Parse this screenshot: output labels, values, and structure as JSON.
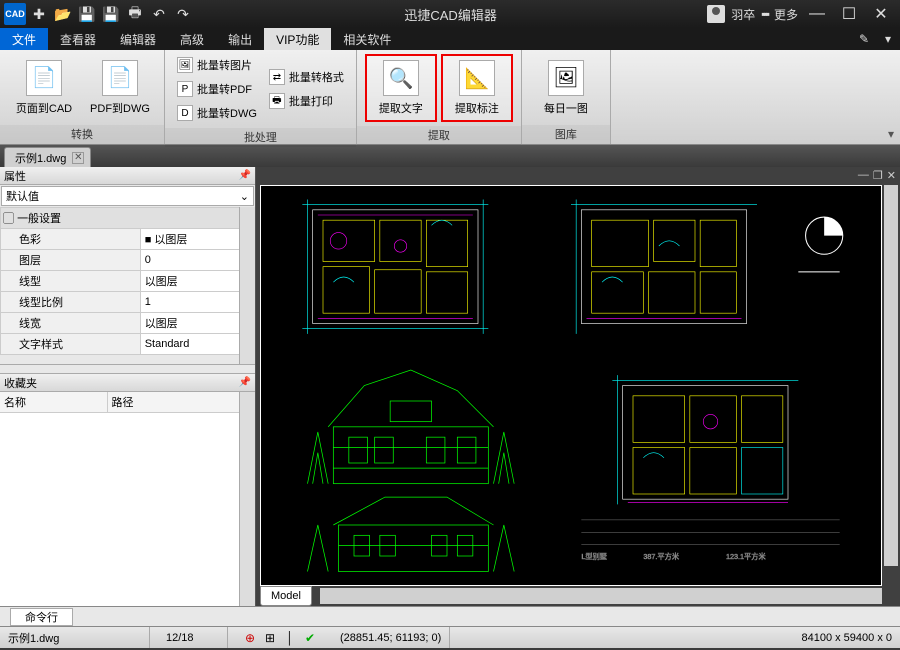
{
  "app": {
    "title": "迅捷CAD编辑器",
    "user": "羽卒",
    "more": "更多"
  },
  "menutabs": {
    "file": "文件",
    "items": [
      "查看器",
      "编辑器",
      "高级",
      "输出",
      "VIP功能",
      "相关软件"
    ],
    "active_index": 4
  },
  "ribbon": {
    "groups": [
      {
        "caption": "转换",
        "big": [
          {
            "label": "页面到CAD"
          },
          {
            "label": "PDF到DWG"
          }
        ]
      },
      {
        "caption": "批处理",
        "small_col1": [
          {
            "label": "批量转图片"
          },
          {
            "label": "批量转PDF"
          },
          {
            "label": "批量转DWG"
          }
        ],
        "small_col2": [
          {
            "label": "批量转格式"
          },
          {
            "label": "批量打印"
          }
        ]
      },
      {
        "caption": "提取",
        "big": [
          {
            "label": "提取文字",
            "hl": true
          },
          {
            "label": "提取标注",
            "hl": true
          }
        ]
      },
      {
        "caption": "图库",
        "big": [
          {
            "label": "每日一图"
          }
        ]
      }
    ]
  },
  "document": {
    "filename": "示例1.dwg"
  },
  "properties": {
    "panel_title": "属性",
    "selector": "默认值",
    "section": "一般设置",
    "rows": [
      {
        "k": "色彩",
        "v": "■ 以图层"
      },
      {
        "k": "图层",
        "v": "0"
      },
      {
        "k": "线型",
        "v": "以图层"
      },
      {
        "k": "线型比例",
        "v": "1"
      },
      {
        "k": "线宽",
        "v": "以图层"
      },
      {
        "k": "文字样式",
        "v": "Standard"
      }
    ]
  },
  "favorites": {
    "panel_title": "收藏夹",
    "col1": "名称",
    "col2": "路径"
  },
  "model_tab": "Model",
  "command_tab": "命令行",
  "status": {
    "filename": "示例1.dwg",
    "page": "12/18",
    "coords": "(28851.45; 61193; 0)",
    "dims": "84100 x 59400 x 0"
  }
}
